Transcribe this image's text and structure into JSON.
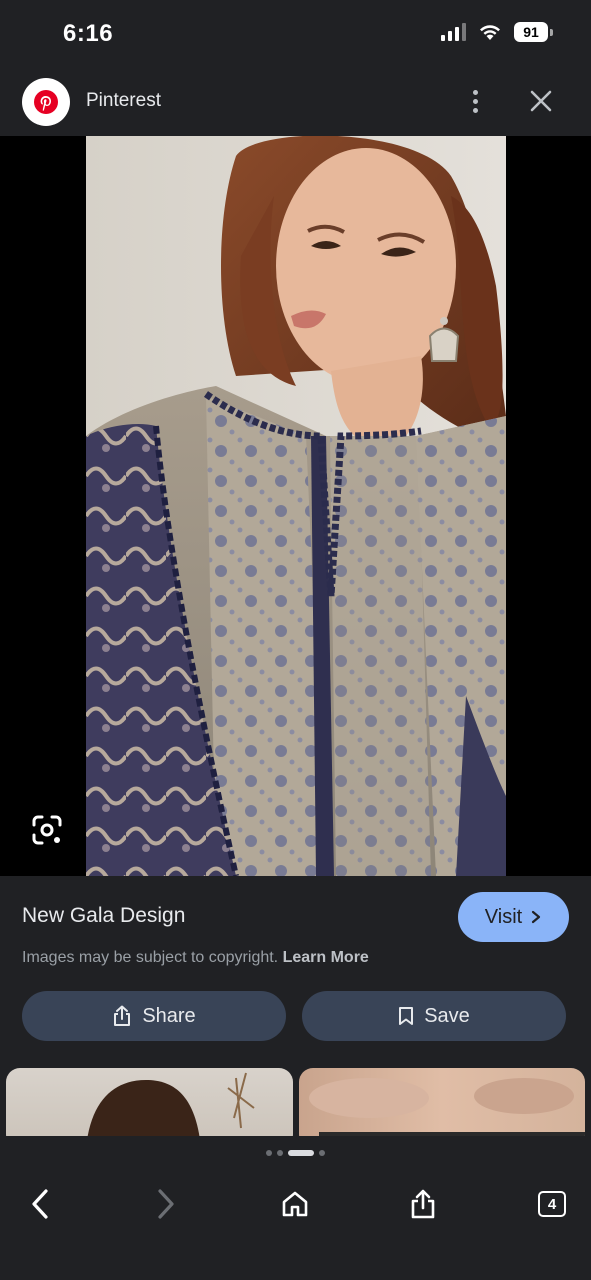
{
  "status_bar": {
    "time": "6:16",
    "battery": "91"
  },
  "header": {
    "source_name": "Pinterest",
    "source_icon": "pinterest-logo-icon",
    "more_icon": "more-vert-icon",
    "close_icon": "close-icon"
  },
  "image": {
    "description_icon": "google-lens-icon"
  },
  "result": {
    "title": "New Gala Design",
    "visit_label": "Visit",
    "copyright_text": "Images may be subject to copyright.",
    "learn_more_label": "Learn More",
    "share_label": "Share",
    "save_label": "Save"
  },
  "toolbar": {
    "tab_count": "4"
  },
  "colors": {
    "background": "#202124",
    "accent": "#8ab4f8",
    "button": "#394457",
    "pinterest_red": "#e60023"
  }
}
